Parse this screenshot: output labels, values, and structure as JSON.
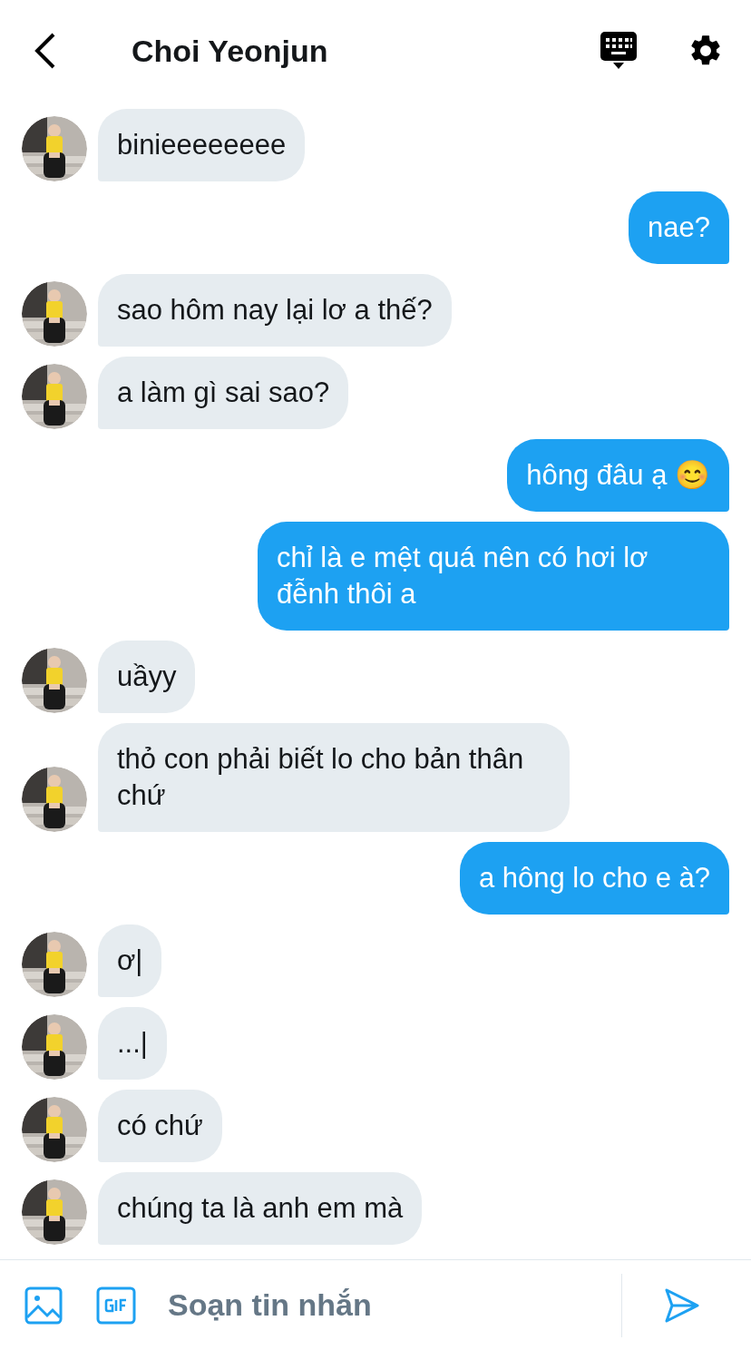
{
  "header": {
    "title": "Choi Yeonjun"
  },
  "messages": [
    {
      "kind": "received",
      "text": "binieeeeeeee"
    },
    {
      "kind": "sent",
      "text": "nae?"
    },
    {
      "kind": "received",
      "text": "sao hôm nay lại lơ a thế?"
    },
    {
      "kind": "received",
      "text": "a làm gì sai sao?"
    },
    {
      "kind": "sent",
      "text": "hông đâu ạ 😊"
    },
    {
      "kind": "sent",
      "text": "chỉ là e mệt quá nên có hơi lơ đễnh thôi a"
    },
    {
      "kind": "received",
      "text": "uầyy"
    },
    {
      "kind": "received",
      "text": "thỏ con phải biết lo cho bản thân chứ"
    },
    {
      "kind": "sent",
      "text": "a hông lo cho e à?"
    },
    {
      "kind": "received",
      "text": "ơ|"
    },
    {
      "kind": "received",
      "text": "...|"
    },
    {
      "kind": "received",
      "text": "có chứ"
    },
    {
      "kind": "received",
      "text": "chúng ta là anh em mà"
    }
  ],
  "composer": {
    "placeholder": "Soạn tin nhắn"
  }
}
